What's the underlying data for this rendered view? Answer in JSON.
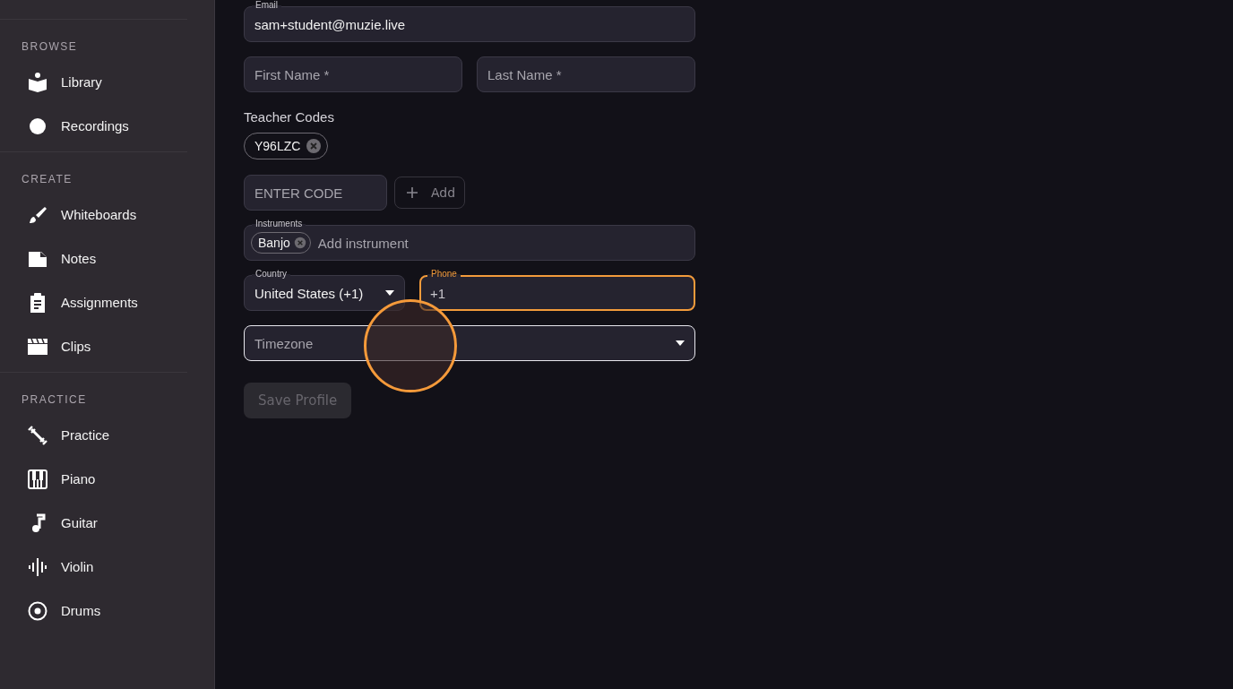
{
  "sidebar": {
    "sections": [
      {
        "title": "BROWSE",
        "items": [
          {
            "label": "Library",
            "kind": "book"
          },
          {
            "label": "Recordings",
            "kind": "dot"
          }
        ]
      },
      {
        "title": "CREATE",
        "items": [
          {
            "label": "Whiteboards",
            "kind": "brush"
          },
          {
            "label": "Notes",
            "kind": "note"
          },
          {
            "label": "Assignments",
            "kind": "clipboard"
          },
          {
            "label": "Clips",
            "kind": "clapper"
          }
        ]
      },
      {
        "title": "PRACTICE",
        "items": [
          {
            "label": "Practice",
            "kind": "dumbbell"
          },
          {
            "label": "Piano",
            "kind": "piano"
          },
          {
            "label": "Guitar",
            "kind": "music"
          },
          {
            "label": "Violin",
            "kind": "wave"
          },
          {
            "label": "Drums",
            "kind": "target"
          }
        ]
      }
    ]
  },
  "form": {
    "email": {
      "label": "Email",
      "value": "sam+student@muzie.live"
    },
    "first_name": {
      "placeholder": "First Name *"
    },
    "last_name": {
      "placeholder": "Last Name *"
    },
    "teacher_codes": {
      "label": "Teacher Codes",
      "chips": [
        "Y96LZC"
      ],
      "placeholder": "ENTER CODE",
      "add_button": "Add"
    },
    "instruments": {
      "label": "Instruments",
      "chips": [
        "Banjo"
      ],
      "placeholder": "Add instrument"
    },
    "country": {
      "label": "Country",
      "value": "United States (+1)"
    },
    "phone": {
      "label": "Phone",
      "value": "+1",
      "focused": true
    },
    "timezone": {
      "placeholder": "Timezone",
      "hovered": true
    },
    "save_button": {
      "label": "Save Profile",
      "disabled": true
    }
  }
}
